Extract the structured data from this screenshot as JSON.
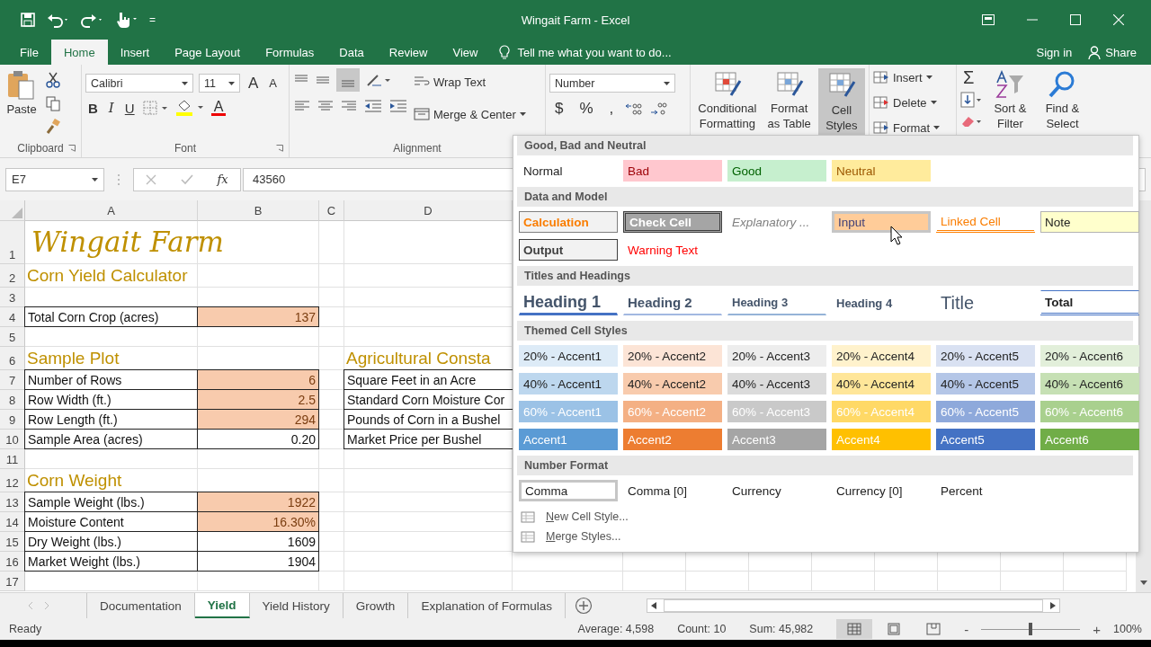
{
  "window": {
    "title": "Wingait Farm - Excel",
    "customize_caret": "="
  },
  "tabs": [
    {
      "label": "File",
      "selected": false
    },
    {
      "label": "Home",
      "selected": true
    },
    {
      "label": "Insert",
      "selected": false
    },
    {
      "label": "Page Layout",
      "selected": false
    },
    {
      "label": "Formulas",
      "selected": false
    },
    {
      "label": "Data",
      "selected": false
    },
    {
      "label": "Review",
      "selected": false
    },
    {
      "label": "View",
      "selected": false
    }
  ],
  "tell_me": {
    "placeholder": "Tell me what you want to do..."
  },
  "account": {
    "sign_in": "Sign in",
    "share": "Share"
  },
  "ribbon": {
    "clipboard": {
      "paste": "Paste",
      "label": "Clipboard"
    },
    "font": {
      "name": "Calibri",
      "size": "11",
      "grow": "A",
      "shrink": "A",
      "bold": "B",
      "italic": "I",
      "underline": "U",
      "font_color": "A",
      "label": "Font"
    },
    "alignment": {
      "wrap": "Wrap Text",
      "merge": "Merge & Center",
      "label": "Alignment"
    },
    "number": {
      "format": "Number",
      "currency": "$",
      "percent": "%",
      "comma": ","
    },
    "styles": [
      {
        "label": "Conditional Formatting",
        "selected": false
      },
      {
        "label": "Format as Table",
        "selected": false
      },
      {
        "label": "Cell Styles",
        "selected": true
      }
    ],
    "cells": [
      "Insert",
      "Delete",
      "Format"
    ],
    "editing": {
      "sum": "Σ",
      "sort": "Sort & Filter",
      "find": "Find & Select"
    }
  },
  "formula_bar": {
    "name_box": "E7",
    "fx": "fx",
    "value": "43560"
  },
  "sheet": {
    "columns": [
      "A",
      "B",
      "C",
      "D"
    ],
    "rows": [
      {
        "number": "1",
        "a": {
          "text": "Wingait Farm",
          "kind": "title"
        }
      },
      {
        "number": "2",
        "a": {
          "text": "Corn Yield Calculator",
          "kind": "heading"
        }
      },
      {
        "number": "3"
      },
      {
        "number": "4",
        "a": {
          "text": "Total Corn Crop (acres)",
          "kind": "label"
        },
        "b": {
          "text": "137",
          "kind": "input"
        }
      },
      {
        "number": "5"
      },
      {
        "number": "6",
        "a": {
          "text": "Sample Plot",
          "kind": "heading"
        },
        "d": {
          "text": "Agricultural Consta",
          "kind": "heading"
        }
      },
      {
        "number": "7",
        "a": {
          "text": "Number of Rows",
          "kind": "label"
        },
        "b": {
          "text": "6",
          "kind": "input"
        },
        "d": {
          "text": "Square Feet in an Acre",
          "kind": "label"
        }
      },
      {
        "number": "8",
        "a": {
          "text": "Row Width (ft.)",
          "kind": "label"
        },
        "b": {
          "text": "2.5",
          "kind": "input"
        },
        "d": {
          "text": "Standard Corn Moisture Cor",
          "kind": "label"
        }
      },
      {
        "number": "9",
        "a": {
          "text": "Row Length (ft.)",
          "kind": "label"
        },
        "b": {
          "text": "294",
          "kind": "input"
        },
        "d": {
          "text": "Pounds of Corn in a Bushel",
          "kind": "label"
        }
      },
      {
        "number": "10",
        "a": {
          "text": "Sample Area (acres)",
          "kind": "label"
        },
        "b": {
          "text": "0.20",
          "kind": "value"
        },
        "d": {
          "text": "Market Price per Bushel",
          "kind": "label"
        }
      },
      {
        "number": "11"
      },
      {
        "number": "12",
        "a": {
          "text": "Corn Weight",
          "kind": "heading"
        }
      },
      {
        "number": "13",
        "a": {
          "text": "Sample Weight (lbs.)",
          "kind": "label"
        },
        "b": {
          "text": "1922",
          "kind": "input"
        }
      },
      {
        "number": "14",
        "a": {
          "text": "Moisture Content",
          "kind": "label"
        },
        "b": {
          "text": "16.30%",
          "kind": "input"
        }
      },
      {
        "number": "15",
        "a": {
          "text": "Dry Weight (lbs.)",
          "kind": "label"
        },
        "b": {
          "text": "1609",
          "kind": "value"
        }
      },
      {
        "number": "16",
        "a": {
          "text": "Market Weight (lbs.)",
          "kind": "label"
        },
        "b": {
          "text": "1904",
          "kind": "value"
        }
      },
      {
        "number": "17"
      }
    ]
  },
  "cell_styles": {
    "sections": [
      {
        "title": "Good, Bad and Neutral",
        "styles": [
          {
            "text": "Normal",
            "kind": "normal",
            "selected": false
          },
          {
            "text": "Bad",
            "kind": "bad",
            "selected": false
          },
          {
            "text": "Good",
            "kind": "good",
            "selected": false
          },
          {
            "text": "Neutral",
            "kind": "neutral",
            "selected": false
          }
        ]
      },
      {
        "title": "Data and Model",
        "styles": [
          {
            "text": "Calculation",
            "kind": "calculation",
            "selected": false
          },
          {
            "text": "Check Cell",
            "kind": "check",
            "selected": false
          },
          {
            "text": "Explanatory ...",
            "kind": "explanatory",
            "selected": false
          },
          {
            "text": "Input",
            "kind": "input",
            "selected": true
          },
          {
            "text": "Linked Cell",
            "kind": "linked",
            "selected": false
          },
          {
            "text": "Note",
            "kind": "note",
            "selected": false
          },
          {
            "text": "Output",
            "kind": "output",
            "selected": false
          },
          {
            "text": "Warning Text",
            "kind": "warning",
            "selected": false
          }
        ]
      },
      {
        "title": "Titles and Headings",
        "styles": [
          {
            "text": "Heading 1",
            "kind": "heading1",
            "selected": false
          },
          {
            "text": "Heading 2",
            "kind": "heading2",
            "selected": false
          },
          {
            "text": "Heading 3",
            "kind": "heading3",
            "selected": false
          },
          {
            "text": "Heading 4",
            "kind": "heading4",
            "selected": false
          },
          {
            "text": "Title",
            "kind": "title",
            "selected": false
          },
          {
            "text": "Total",
            "kind": "total",
            "selected": false
          }
        ]
      },
      {
        "title": "Themed Cell Styles",
        "styles": [
          {
            "text": "20% - Accent1",
            "kind": "tint20",
            "color": "#ddebf7",
            "selected": false
          },
          {
            "text": "20% - Accent2",
            "kind": "tint20",
            "color": "#fce4d6",
            "selected": false
          },
          {
            "text": "20% - Accent3",
            "kind": "tint20",
            "color": "#ededed",
            "selected": false
          },
          {
            "text": "20% - Accent4",
            "kind": "tint20",
            "color": "#fff2cc",
            "selected": false
          },
          {
            "text": "20% - Accent5",
            "kind": "tint20",
            "color": "#d9e1f2",
            "selected": false
          },
          {
            "text": "20% - Accent6",
            "kind": "tint20",
            "color": "#e2efda",
            "selected": false
          },
          {
            "text": "40% - Accent1",
            "kind": "tint40",
            "color": "#bdd7ee",
            "selected": false
          },
          {
            "text": "40% - Accent2",
            "kind": "tint40",
            "color": "#f8cbad",
            "selected": false
          },
          {
            "text": "40% - Accent3",
            "kind": "tint40",
            "color": "#dbdbdb",
            "selected": false
          },
          {
            "text": "40% - Accent4",
            "kind": "tint40",
            "color": "#ffe699",
            "selected": false
          },
          {
            "text": "40% - Accent5",
            "kind": "tint40",
            "color": "#b4c6e7",
            "selected": false
          },
          {
            "text": "40% - Accent6",
            "kind": "tint40",
            "color": "#c6e0b4",
            "selected": false
          },
          {
            "text": "60% - Accent1",
            "kind": "tint60",
            "color": "#9bc2e6",
            "selected": false
          },
          {
            "text": "60% - Accent2",
            "kind": "tint60",
            "color": "#f4b084",
            "selected": false
          },
          {
            "text": "60% - Accent3",
            "kind": "tint60",
            "color": "#c9c9c9",
            "selected": false
          },
          {
            "text": "60% - Accent4",
            "kind": "tint60",
            "color": "#ffd966",
            "selected": false
          },
          {
            "text": "60% - Accent5",
            "kind": "tint60",
            "color": "#8ea9db",
            "selected": false
          },
          {
            "text": "60% - Accent6",
            "kind": "tint60",
            "color": "#a9d08e",
            "selected": false
          },
          {
            "text": "Accent1",
            "kind": "accent",
            "color": "#5b9bd5",
            "selected": false
          },
          {
            "text": "Accent2",
            "kind": "accent",
            "color": "#ed7d31",
            "selected": false
          },
          {
            "text": "Accent3",
            "kind": "accent",
            "color": "#a5a5a5",
            "selected": false
          },
          {
            "text": "Accent4",
            "kind": "accent",
            "color": "#ffc000",
            "selected": false
          },
          {
            "text": "Accent5",
            "kind": "accent",
            "color": "#4472c4",
            "selected": false
          },
          {
            "text": "Accent6",
            "kind": "accent",
            "color": "#70ad47",
            "selected": false
          }
        ]
      },
      {
        "title": "Number Format",
        "styles": [
          {
            "text": "Comma",
            "kind": "normal",
            "selected": true
          },
          {
            "text": "Comma [0]",
            "kind": "normal",
            "selected": false
          },
          {
            "text": "Currency",
            "kind": "normal",
            "selected": false
          },
          {
            "text": "Currency [0]",
            "kind": "normal",
            "selected": false
          },
          {
            "text": "Percent",
            "kind": "normal",
            "selected": false
          }
        ]
      }
    ],
    "commands": [
      "New Cell Style...",
      "Merge Styles..."
    ]
  },
  "sheet_tabs": [
    {
      "label": "Documentation",
      "selected": false
    },
    {
      "label": "Yield",
      "selected": true
    },
    {
      "label": "Yield History",
      "selected": false
    },
    {
      "label": "Growth",
      "selected": false
    },
    {
      "label": "Explanation of Formulas",
      "selected": false
    }
  ],
  "status_bar": {
    "status": "Ready",
    "average": "Average: 4,598",
    "count": "Count: 10",
    "sum": "Sum: 45,982",
    "views": [
      {
        "kind": "normal",
        "selected": true
      },
      {
        "kind": "page_layout",
        "selected": false
      },
      {
        "kind": "page_break",
        "selected": false
      }
    ],
    "zoom": {
      "level": 0.5,
      "reading": "100%",
      "minus": "-",
      "plus": "+"
    }
  }
}
